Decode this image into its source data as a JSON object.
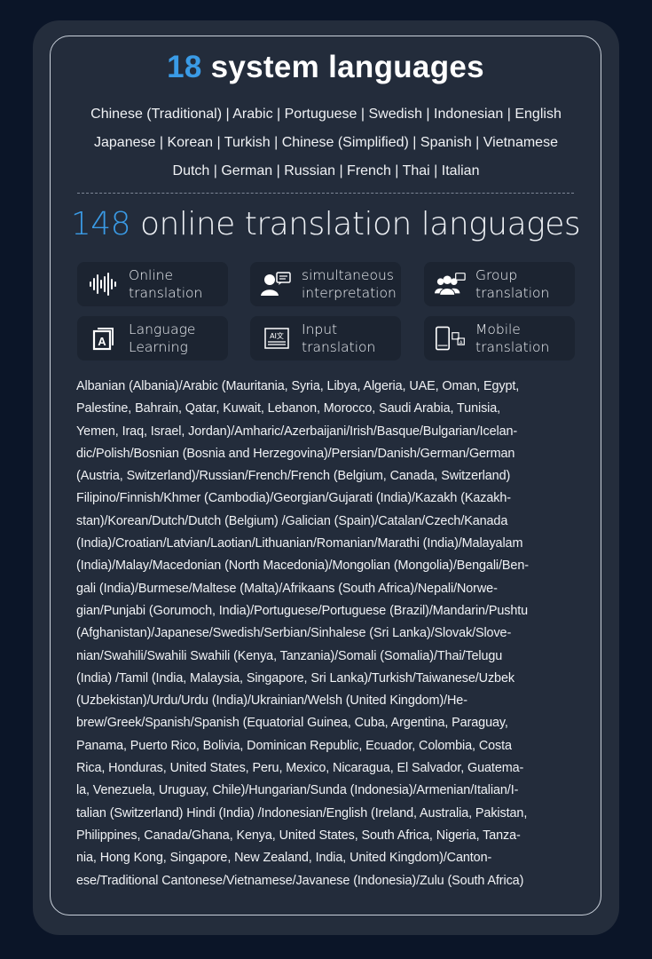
{
  "colors": {
    "accent": "#3a9be6",
    "background": "#0b1528",
    "panel": "#242d3c",
    "tile": "#1c2431"
  },
  "system_languages": {
    "count": "18",
    "title_rest": " system languages",
    "lines": [
      "Chinese (Traditional) | Arabic | Portuguese | Swedish | Indonesian | English",
      "Japanese | Korean | Turkish | Chinese (Simplified) | Spanish | Vietnamese",
      "Dutch | German | Russian | French | Thai | Italian"
    ]
  },
  "online_languages": {
    "count": "148",
    "title_rest": " online translation languages"
  },
  "features": [
    {
      "icon": "sound-wave-icon",
      "line1": "Online",
      "line2": "translation"
    },
    {
      "icon": "speaker-chat-icon",
      "line1": "simultaneous",
      "line2": "interpretation"
    },
    {
      "icon": "group-chat-icon",
      "line1": "Group",
      "line2": "translation"
    },
    {
      "icon": "language-book-icon",
      "line1": "Language",
      "line2": "Learning"
    },
    {
      "icon": "ai-text-icon",
      "line1": "Input",
      "line2": "translation"
    },
    {
      "icon": "mobile-translate-icon",
      "line1": "Mobile",
      "line2": "translation"
    }
  ],
  "language_list_lines": [
    "Albanian (Albania)/Arabic (Mauritania, Syria, Libya, Algeria, UAE, Oman, Egypt,",
    "Palestine, Bahrain, Qatar, Kuwait, Lebanon, Morocco, Saudi Arabia, Tunisia,",
    "Yemen, Iraq, Israel, Jordan)/Amharic/Azerbaijani/Irish/Basque/Bulgarian/Icelan-",
    "dic/Polish/Bosnian (Bosnia and Herzegovina)/Persian/Danish/German/German",
    "(Austria, Switzerland)/Russian/French/French (Belgium, Canada, Switzerland)",
    "Filipino/Finnish/Khmer (Cambodia)/Georgian/Gujarati (India)/Kazakh (Kazakh-",
    "stan)/Korean/Dutch/Dutch (Belgium) /Galician (Spain)/Catalan/Czech/Kanada",
    "(India)/Croatian/Latvian/Laotian/Lithuanian/Romanian/Marathi (India)/Malayalam",
    "(India)/Malay/Macedonian (North Macedonia)/Mongolian (Mongolia)/Bengali/Ben-",
    "gali (India)/Burmese/Maltese (Malta)/Afrikaans (South Africa)/Nepali/Norwe-",
    "gian/Punjabi (Gorumoch, India)/Portuguese/Portuguese (Brazil)/Mandarin/Pushtu",
    "(Afghanistan)/Japanese/Swedish/Serbian/Sinhalese (Sri Lanka)/Slovak/Slove-",
    "nian/Swahili/Swahili Swahili (Kenya, Tanzania)/Somali (Somalia)/Thai/Telugu",
    "(India) /Tamil (India, Malaysia, Singapore, Sri Lanka)/Turkish/Taiwanese/Uzbek",
    "(Uzbekistan)/Urdu/Urdu (India)/Ukrainian/Welsh (United Kingdom)/He-",
    "brew/Greek/Spanish/Spanish (Equatorial Guinea, Cuba, Argentina, Paraguay,",
    "Panama, Puerto Rico, Bolivia, Dominican Republic, Ecuador, Colombia, Costa",
    "Rica, Honduras, United States, Peru, Mexico, Nicaragua, El Salvador, Guatema-",
    "la, Venezuela, Uruguay, Chile)/Hungarian/Sunda (Indonesia)/Armenian/Italian/I-",
    "talian (Switzerland) Hindi (India) /Indonesian/English (Ireland, Australia, Pakistan,",
    "Philippines, Canada/Ghana, Kenya, United States, South Africa, Nigeria, Tanza-",
    "nia, Hong Kong, Singapore, New Zealand, India, United Kingdom)/Canton-",
    "ese/Traditional Cantonese/Vietnamese/Javanese (Indonesia)/Zulu (South Africa)"
  ]
}
